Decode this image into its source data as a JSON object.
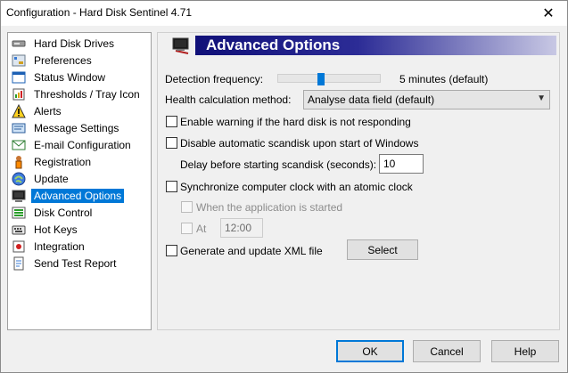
{
  "window": {
    "title": "Configuration  -  Hard Disk Sentinel 4.71",
    "close_glyph": "✕"
  },
  "sidebar": {
    "items": [
      {
        "label": "Hard Disk Drives",
        "icon": "hard-disk-icon"
      },
      {
        "label": "Preferences",
        "icon": "preferences-icon"
      },
      {
        "label": "Status Window",
        "icon": "status-window-icon"
      },
      {
        "label": "Thresholds / Tray Icon",
        "icon": "thresholds-icon"
      },
      {
        "label": "Alerts",
        "icon": "alert-icon"
      },
      {
        "label": "Message Settings",
        "icon": "message-icon"
      },
      {
        "label": "E-mail Configuration",
        "icon": "email-icon"
      },
      {
        "label": "Registration",
        "icon": "registration-icon"
      },
      {
        "label": "Update",
        "icon": "update-icon"
      },
      {
        "label": "Advanced Options",
        "icon": "advanced-options-icon",
        "selected": true
      },
      {
        "label": "Disk Control",
        "icon": "disk-control-icon"
      },
      {
        "label": "Hot Keys",
        "icon": "hot-keys-icon"
      },
      {
        "label": "Integration",
        "icon": "integration-icon"
      },
      {
        "label": "Send Test Report",
        "icon": "send-report-icon"
      }
    ]
  },
  "panel": {
    "title": "Advanced Options",
    "detection": {
      "label": "Detection frequency:",
      "value": "5 minutes (default)"
    },
    "health": {
      "label": "Health calculation method:",
      "selected": "Analyse data field (default)"
    },
    "warn_not_responding": {
      "label": "Enable warning if the hard disk is not responding",
      "checked": false
    },
    "disable_scandisk": {
      "label": "Disable automatic scandisk upon start of Windows",
      "checked": false
    },
    "delay": {
      "label": "Delay before starting scandisk (seconds):",
      "value": "10"
    },
    "sync_clock": {
      "label": "Synchronize computer clock with an atomic clock",
      "checked": false
    },
    "when_started": {
      "label": "When the application is started",
      "checked": false
    },
    "at": {
      "label": "At",
      "value": "12:00",
      "checked": false
    },
    "xml": {
      "label": "Generate and update XML file",
      "checked": false
    },
    "select_button": "Select"
  },
  "footer": {
    "ok": "OK",
    "cancel": "Cancel",
    "help": "Help"
  },
  "colors": {
    "selection": "#0078d7",
    "header_gradient_start": "#101078",
    "header_gradient_end": "#c8c8e4"
  }
}
